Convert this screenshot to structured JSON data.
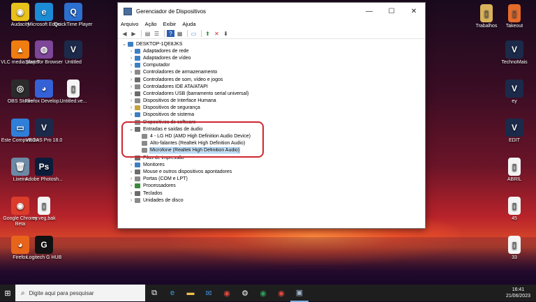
{
  "desktop": {
    "left_icons": [
      {
        "label": "Audacity",
        "glyph": "◉",
        "color": "#e8c21a"
      },
      {
        "label": "Microsoft Edge",
        "glyph": "e",
        "color": "#1c8bd6"
      },
      {
        "label": "QuickTime Player",
        "glyph": "Q",
        "color": "#2b6fcf"
      },
      {
        "label": "VLC media player",
        "glyph": "▲",
        "color": "#ef7d10"
      },
      {
        "label": "Start Tor Browser",
        "glyph": "◍",
        "color": "#7d4698"
      },
      {
        "label": "Untitled",
        "glyph": "V",
        "color": "#1b2a4a"
      },
      {
        "label": "OBS Studio",
        "glyph": "◎",
        "color": "#2b2b2b"
      },
      {
        "label": "Firefox Develop...",
        "glyph": "◕",
        "color": "#3461d6"
      },
      {
        "label": "Untitled.ve...",
        "glyph": "▯",
        "color": "#f4f4f4"
      },
      {
        "label": "Este Computador",
        "glyph": "▭",
        "color": "#2f7fd8"
      },
      {
        "label": "VEGAS Pro 18.0",
        "glyph": "V",
        "color": "#1b2a4a"
      },
      {
        "label": "Lixeira",
        "glyph": "🗑",
        "color": "#6c8aa6"
      },
      {
        "label": "Adobe Photosh...",
        "glyph": "Ps",
        "color": "#0b1d3a"
      },
      {
        "label": "Google Chrome Beta",
        "glyph": "◉",
        "color": "#dc3c2c"
      },
      {
        "label": "ey.veg.bak",
        "glyph": "▯",
        "color": "#f4f4f4"
      },
      {
        "label": "Firefox",
        "glyph": "◕",
        "color": "#e8641b"
      },
      {
        "label": "Logitech G HUB",
        "glyph": "G",
        "color": "#111111"
      }
    ],
    "right_icons": [
      {
        "label": "Trabalhos",
        "glyph": "▯",
        "color": "#d9b25a"
      },
      {
        "label": "Takeout",
        "glyph": "▯",
        "color": "#e56b2b"
      },
      {
        "label": "TechnoMais",
        "glyph": "V",
        "color": "#1b2a4a"
      },
      {
        "label": "ey",
        "glyph": "V",
        "color": "#1b2a4a"
      },
      {
        "label": "EDIT",
        "glyph": "V",
        "color": "#1b2a4a"
      },
      {
        "label": "ABRIL",
        "glyph": "▯",
        "color": "#f4f4f4"
      },
      {
        "label": "45",
        "glyph": "▯",
        "color": "#f4f4f4"
      },
      {
        "label": "33",
        "glyph": "▯",
        "color": "#f4f4f4"
      }
    ]
  },
  "window": {
    "title": "Gerenciador de Dispositivos",
    "controls": [
      "—",
      "☐",
      "✕"
    ],
    "menu": [
      "Arquivo",
      "Ação",
      "Exibir",
      "Ajuda"
    ],
    "toolbar_icons": [
      "back-icon",
      "forward-icon",
      "properties-icon",
      "list-icon",
      "help-icon",
      "view-icon",
      "monitor-icon",
      "enable-device-icon",
      "uninstall-icon",
      "download-icon"
    ],
    "root": "DESKTOP-1QE8JKS",
    "tree": [
      {
        "label": "Adaptadores de rede",
        "color": "#3d7fc4"
      },
      {
        "label": "Adaptadores de vídeo",
        "color": "#3d7fc4"
      },
      {
        "label": "Computador",
        "color": "#3d7fc4"
      },
      {
        "label": "Controladores de armazenamento",
        "color": "#8a8a8a"
      },
      {
        "label": "Controladores de som, vídeo e jogos",
        "color": "#6c6c6c"
      },
      {
        "label": "Controladores IDE ATA/ATAPI",
        "color": "#8a8a8a"
      },
      {
        "label": "Controladores USB (barramento serial universal)",
        "color": "#6c6c6c"
      },
      {
        "label": "Dispositivos de Interface Humana",
        "color": "#8a8a8a"
      },
      {
        "label": "Dispositivos de segurança",
        "color": "#c8a23a"
      },
      {
        "label": "Dispositivos de sistema",
        "color": "#3d7fc4"
      },
      {
        "label": "Dispositivos de software",
        "color": "#8a8a8a"
      }
    ],
    "audio_group": {
      "label": "Entradas e saídas de áudio",
      "children": [
        {
          "label": "4 - LG HD (AMD High Definition Audio Device)",
          "selected": false
        },
        {
          "label": "Alto-falantes (Realtek High Definition Audio)",
          "selected": false
        },
        {
          "label": "Microfone (Realtek High Definition Audio)",
          "selected": true
        }
      ]
    },
    "tree_after": [
      {
        "label": "Filas de impressão",
        "color": "#6c6c6c"
      },
      {
        "label": "Monitores",
        "color": "#3d7fc4"
      },
      {
        "label": "Mouse e outros dispositivos apontadores",
        "color": "#6c6c6c"
      },
      {
        "label": "Portas (COM e LPT)",
        "color": "#8a8a8a"
      },
      {
        "label": "Processadores",
        "color": "#3b8a3b"
      },
      {
        "label": "Teclados",
        "color": "#6c6c6c"
      },
      {
        "label": "Unidades de disco",
        "color": "#8a8a8a"
      }
    ]
  },
  "taskbar": {
    "search_placeholder": "Digite aqui para pesquisar",
    "time": "16:41",
    "date": "21/06/2023",
    "apps": [
      "task-view-icon",
      "edge-icon",
      "explorer-icon",
      "mail-icon",
      "chrome-icon",
      "settings-icon",
      "chrome-beta-icon",
      "chrome-icon-2",
      "device-manager-icon"
    ]
  }
}
